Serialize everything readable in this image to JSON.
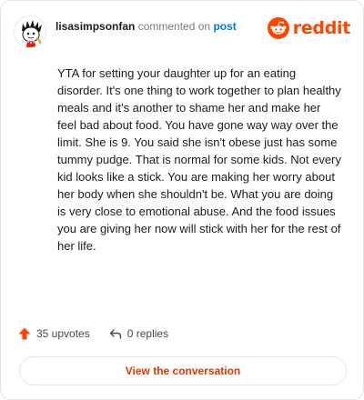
{
  "header": {
    "username": "lisasimpsonfan",
    "action_text": "commented on",
    "post_link": "post",
    "brand_name": "reddit"
  },
  "comment": {
    "body": "YTA for setting your daughter up for an eating disorder. It's one thing to work together to plan healthy meals and it's another to shame her and make her feel bad about food. You have gone way way over the limit. She is 9. You said she isn't obese just has some tummy pudge. That is normal for some kids. Not every kid looks like a stick. You are making her worry about her body when she shouldn't be. What you are doing is very close to emotional abuse. And the food issues you are giving her now will stick with her for the rest of her life."
  },
  "footer": {
    "upvotes": "35 upvotes",
    "replies": "0 replies",
    "view_button": "View the conversation"
  },
  "colors": {
    "brand": "#ff4500",
    "link": "#0079d3",
    "button_text": "#d93a00",
    "text": "#1c1c1c",
    "muted": "#7c7c7c"
  },
  "icons": {
    "avatar": "snoo-avatar",
    "brand": "reddit-logo-icon",
    "upvote": "upvote-arrow-icon",
    "reply": "reply-arrow-icon"
  }
}
